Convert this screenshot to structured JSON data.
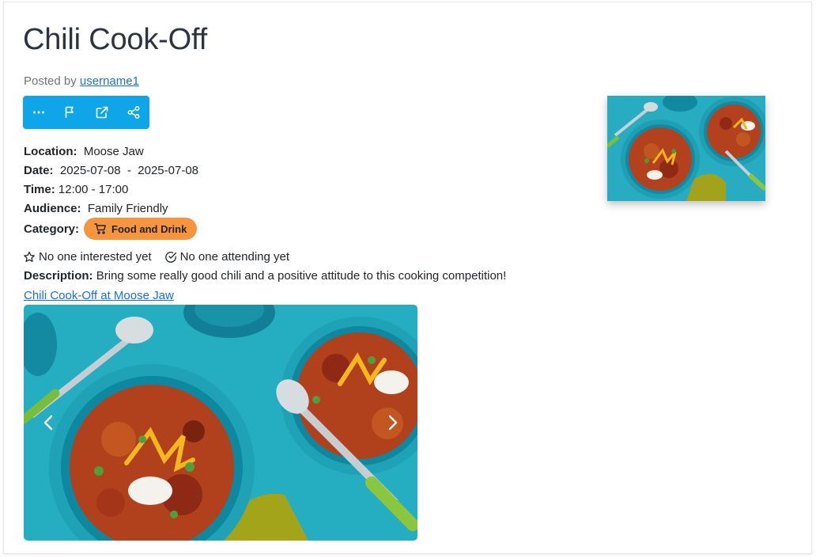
{
  "event": {
    "title": "Chili Cook-Off",
    "posted_prefix": "Posted by",
    "posted_user": "username1",
    "location_label": "Location:",
    "location_value": "Moose Jaw",
    "date_label": "Date:",
    "date_start": "2025-07-08",
    "date_sep": "-",
    "date_end": "2025-07-08",
    "time_label": "Time:",
    "time_value": "12:00 - 17:00",
    "audience_label": "Audience:",
    "audience_value": "Family Friendly",
    "category_label": "Category:",
    "category_value": "Food and Drink",
    "interested_text": "No one interested yet",
    "attending_text": "No one attending yet",
    "description_label": "Description:",
    "description_value": "Bring some really good chili and a positive attitude to this cooking competition!",
    "link_text": "Chili Cook-Off at Moose Jaw"
  },
  "toolbar": {
    "icons": [
      "more-icon",
      "flag-icon",
      "external-link-icon",
      "share-icon"
    ]
  },
  "colors": {
    "toolbar_bg": "#0ea5e9",
    "badge_bg": "#f7953f",
    "link": "#1a6fd8"
  }
}
